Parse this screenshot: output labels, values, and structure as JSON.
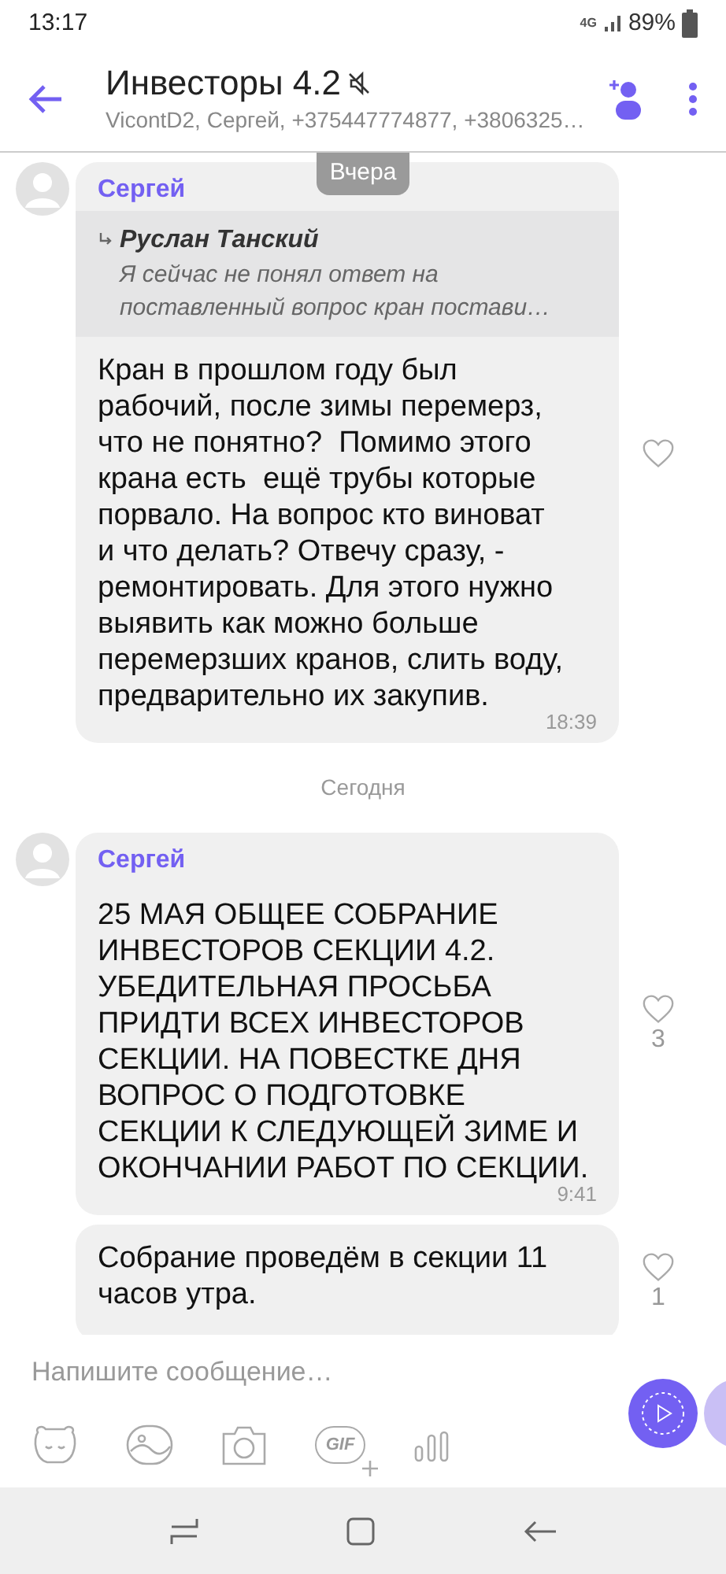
{
  "status_bar": {
    "time": "13:17",
    "network": "4G",
    "battery": "89%"
  },
  "header": {
    "title": "Инвесторы 4.2",
    "muted": true,
    "subtitle": "VicontD2, Сергей, +375447774877, +3806325…"
  },
  "sticky_date": "Вчера",
  "messages": [
    {
      "kind": "message",
      "avatar": true,
      "sender": "Сергей",
      "quote": {
        "author": "Руслан Танский",
        "text": "Я сейчас не понял ответ на\nпоставленный вопрос кран постави…"
      },
      "text": "Кран в прошлом году был\nрабочий, после зимы перемерз,\nчто не понятно?  Помимо этого\nкрана есть  ещё трубы которые\nпорвало. На вопрос кто виноват\nи что делать? Отвечу сразу, -\nремонтировать. Для этого нужно\nвыявить как можно больше\nперемерзших кранов, слить воду,\nпредварительно их закупив.",
      "time": "18:39"
    },
    {
      "kind": "date",
      "text": "Сегодня"
    },
    {
      "kind": "message",
      "avatar": true,
      "sender": "Сергей",
      "text": "25 МАЯ ОБЩЕЕ СОБРАНИЕ\nИНВЕСТОРОВ СЕКЦИИ 4.2.\nУБЕДИТЕЛЬНАЯ ПРОСЬБА\nПРИДТИ ВСЕХ ИНВЕСТОРОВ\nСЕКЦИИ. НА ПОВЕСТКЕ ДНЯ\nВОПРОС О ПОДГОТОВКЕ\nСЕКЦИИ К СЛЕДУЮЩЕЙ ЗИМЕ И\nОКОНЧАНИИ РАБОТ ПО СЕКЦИИ.",
      "time": "9:41",
      "likes": "3"
    },
    {
      "kind": "message",
      "avatar": false,
      "text": "Собрание проведём в секции 11\nчасов утра.",
      "likes": "1"
    }
  ],
  "composer": {
    "placeholder": "Напишите сообщение…",
    "gif_label": "GIF"
  }
}
